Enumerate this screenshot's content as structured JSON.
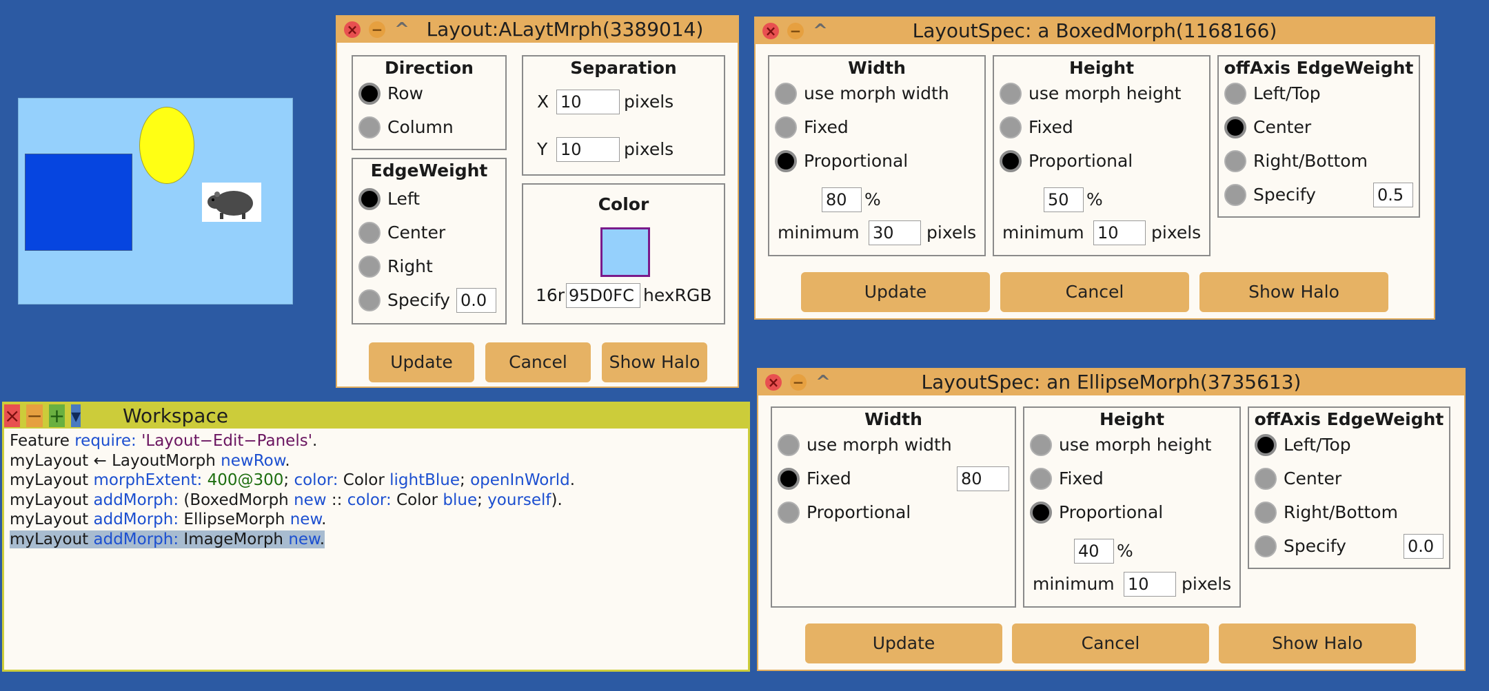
{
  "windows": {
    "layout": {
      "title": "Layout:ALaytMrph(3389014)",
      "direction": {
        "heading": "Direction",
        "options": [
          "Row",
          "Column"
        ],
        "selected": "Row"
      },
      "separation": {
        "heading": "Separation",
        "x_label": "X",
        "x_value": "10",
        "y_label": "Y",
        "y_value": "10",
        "unit": "pixels"
      },
      "edge_weight": {
        "heading": "EdgeWeight",
        "options": [
          "Left",
          "Center",
          "Right",
          "Specify"
        ],
        "selected": "Left",
        "specify_value": "0.0"
      },
      "color": {
        "heading": "Color",
        "prefix": "16r",
        "value": "95D0FC",
        "suffix": "hexRGB",
        "swatch": "#95d0fc"
      },
      "buttons": [
        "Update",
        "Cancel",
        "Show Halo"
      ]
    },
    "boxed": {
      "title": "LayoutSpec: a BoxedMorph(1168166)",
      "width": {
        "heading": "Width",
        "options": [
          "use morph width",
          "Fixed",
          "Proportional"
        ],
        "selected": "Proportional",
        "percent": "80",
        "percent_sign": "%",
        "min_label": "minimum",
        "min_value": "30",
        "unit": "pixels"
      },
      "height": {
        "heading": "Height",
        "options": [
          "use morph height",
          "Fixed",
          "Proportional"
        ],
        "selected": "Proportional",
        "percent": "50",
        "percent_sign": "%",
        "min_label": "minimum",
        "min_value": "10",
        "unit": "pixels"
      },
      "offaxis": {
        "heading": "offAxis EdgeWeight",
        "options": [
          "Left/Top",
          "Center",
          "Right/Bottom",
          "Specify"
        ],
        "selected": "Center",
        "specify_value": "0.5"
      },
      "buttons": [
        "Update",
        "Cancel",
        "Show Halo"
      ]
    },
    "ellipse": {
      "title": "LayoutSpec: an EllipseMorph(3735613)",
      "width": {
        "heading": "Width",
        "options": [
          "use morph width",
          "Fixed",
          "Proportional"
        ],
        "selected": "Fixed",
        "fixed_value": "80"
      },
      "height": {
        "heading": "Height",
        "options": [
          "use morph height",
          "Fixed",
          "Proportional"
        ],
        "selected": "Proportional",
        "percent": "40",
        "percent_sign": "%",
        "min_label": "minimum",
        "min_value": "10",
        "unit": "pixels"
      },
      "offaxis": {
        "heading": "offAxis EdgeWeight",
        "options": [
          "Left/Top",
          "Center",
          "Right/Bottom",
          "Specify"
        ],
        "selected": "Left/Top",
        "specify_value": "0.0"
      },
      "buttons": [
        "Update",
        "Cancel",
        "Show Halo"
      ]
    },
    "workspace": {
      "title": "Workspace",
      "lines": [
        [
          {
            "t": "Feature ",
            "c": ""
          },
          {
            "t": "require: ",
            "c": "k"
          },
          {
            "t": "'Layout−Edit−Panels'",
            "c": "s"
          },
          {
            "t": ".",
            "c": ""
          }
        ],
        [
          {
            "t": "myLayout ← LayoutMorph ",
            "c": ""
          },
          {
            "t": "newRow",
            "c": "k"
          },
          {
            "t": ".",
            "c": ""
          }
        ],
        [
          {
            "t": "myLayout ",
            "c": ""
          },
          {
            "t": "morphExtent: ",
            "c": "k"
          },
          {
            "t": "400@300",
            "c": "n"
          },
          {
            "t": "; ",
            "c": ""
          },
          {
            "t": "color: ",
            "c": "k"
          },
          {
            "t": "Color ",
            "c": ""
          },
          {
            "t": "lightBlue",
            "c": "k"
          },
          {
            "t": "; ",
            "c": ""
          },
          {
            "t": "openInWorld",
            "c": "k"
          },
          {
            "t": ".",
            "c": ""
          }
        ],
        [
          {
            "t": "myLayout ",
            "c": ""
          },
          {
            "t": "addMorph: ",
            "c": "k"
          },
          {
            "t": "(BoxedMorph ",
            "c": ""
          },
          {
            "t": "new",
            "c": "k"
          },
          {
            "t": " :: ",
            "c": ""
          },
          {
            "t": "color: ",
            "c": "k"
          },
          {
            "t": "Color ",
            "c": ""
          },
          {
            "t": "blue",
            "c": "k"
          },
          {
            "t": "; ",
            "c": ""
          },
          {
            "t": "yourself",
            "c": "k"
          },
          {
            "t": ").",
            "c": ""
          }
        ],
        [
          {
            "t": "myLayout ",
            "c": ""
          },
          {
            "t": "addMorph: ",
            "c": "k"
          },
          {
            "t": "EllipseMorph ",
            "c": ""
          },
          {
            "t": "new",
            "c": "k"
          },
          {
            "t": ".",
            "c": ""
          }
        ],
        [
          {
            "t": "myLayout ",
            "c": ""
          },
          {
            "t": "addMorph: ",
            "c": "k"
          },
          {
            "t": "ImageMorph ",
            "c": ""
          },
          {
            "t": "new",
            "c": "k"
          },
          {
            "t": ".",
            "c": ""
          }
        ]
      ],
      "selected_line": 5
    }
  },
  "colors": {
    "desktop": "#2c5aa3",
    "title_bar": "#e6ae5e",
    "workspace_bar": "#cccc3a",
    "button": "#e6b264",
    "box_blue": "#0645e0",
    "ellipse_yellow": "#ffff14",
    "preview_bg": "#95d0fc"
  },
  "icons": [
    "close-icon",
    "minimize-icon",
    "collapse-icon",
    "grow-icon",
    "menu-icon",
    "rat-image"
  ]
}
